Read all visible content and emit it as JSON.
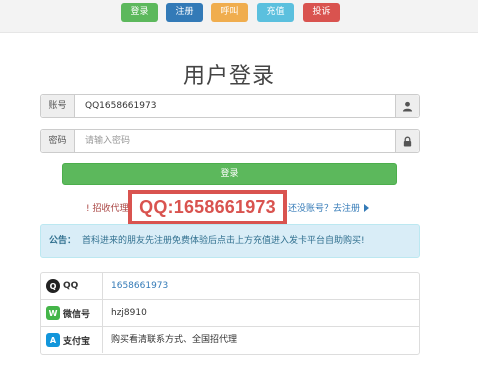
{
  "topbar": {
    "login": "登录",
    "register": "注册",
    "call": "呼叫",
    "recharge": "充值",
    "complaint": "投诉",
    "colors": {
      "login": "#5cb85c",
      "register": "#337ab7",
      "call": "#f0ad4e",
      "recharge": "#5bc0de",
      "complaint": "#d9534f"
    }
  },
  "page_title": "用户登录",
  "form": {
    "account_label": "账号",
    "account_value": "QQ1658661973",
    "password_label": "密码",
    "password_placeholder": "请输入密码",
    "account_icon": "user-icon",
    "password_icon": "lock-icon",
    "login_button": "登录"
  },
  "links": {
    "recruit": "! 招收代理",
    "no_account": "还没账号？去注册"
  },
  "overlay_qq": "QQ:1658661973",
  "notice": {
    "label": "公告：",
    "text": "首科进来的朋友先注册免费体验后点击上方充值进入发卡平台自助购买!"
  },
  "contacts": [
    {
      "icon": "qq-icon",
      "label": "QQ",
      "value": "1658661973"
    },
    {
      "icon": "wechat-icon",
      "label": "微信号",
      "value": "hzj8910"
    },
    {
      "icon": "alipay-icon",
      "label": "支付宝",
      "value": "购买看清联系方式、全国招代理"
    }
  ]
}
